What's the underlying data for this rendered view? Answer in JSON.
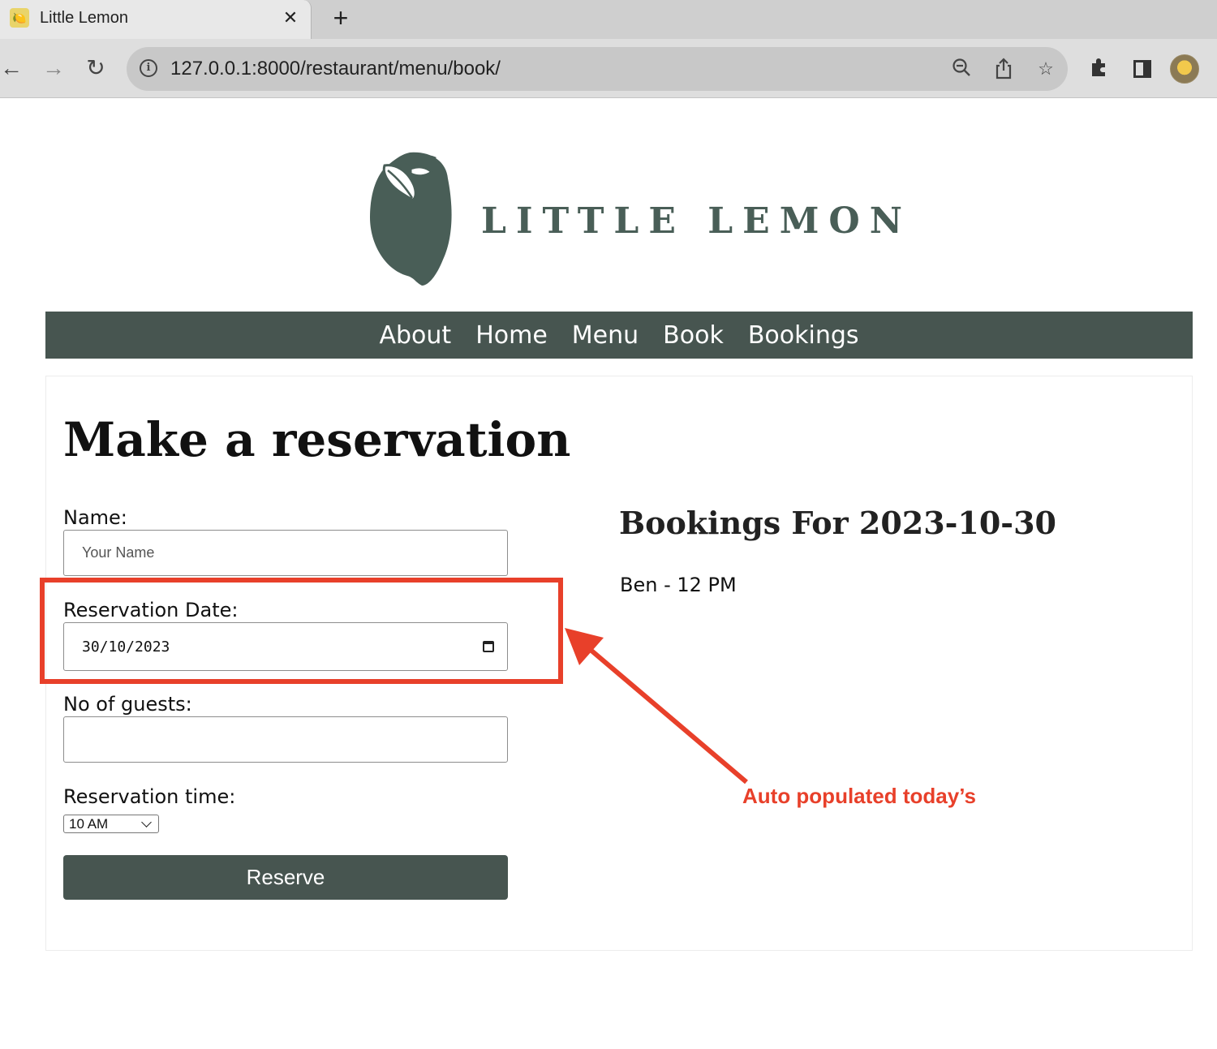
{
  "browser": {
    "tab_title": "Little Lemon",
    "url": "127.0.0.1:8000/restaurant/menu/book/",
    "tab_close_label": "✕",
    "new_tab_label": "+"
  },
  "site": {
    "logo_text": "LITTLE LEMON",
    "nav": [
      "About",
      "Home",
      "Menu",
      "Book",
      "Bookings"
    ]
  },
  "form": {
    "title": "Make a reservation",
    "name_label": "Name:",
    "name_placeholder": "Your Name",
    "name_value": "",
    "date_label": "Reservation Date:",
    "date_value": "30/10/2023",
    "guests_label": "No of guests:",
    "guests_value": "",
    "time_label": "Reservation time:",
    "time_value": "10 AM",
    "submit_label": "Reserve"
  },
  "bookings": {
    "title": "Bookings For 2023-10-30",
    "items": [
      "Ben - 12 PM"
    ]
  },
  "annotation": {
    "text": "Auto populated today’s",
    "color": "#e8402a"
  },
  "colors": {
    "brand_green": "#495e57",
    "nav_bg": "#475550"
  },
  "icons": [
    "back-icon",
    "forward-icon",
    "reload-icon",
    "info-icon",
    "zoom-icon",
    "share-icon",
    "star-icon",
    "extensions-icon",
    "side-panel-icon",
    "calendar-icon",
    "chevron-down-icon"
  ]
}
